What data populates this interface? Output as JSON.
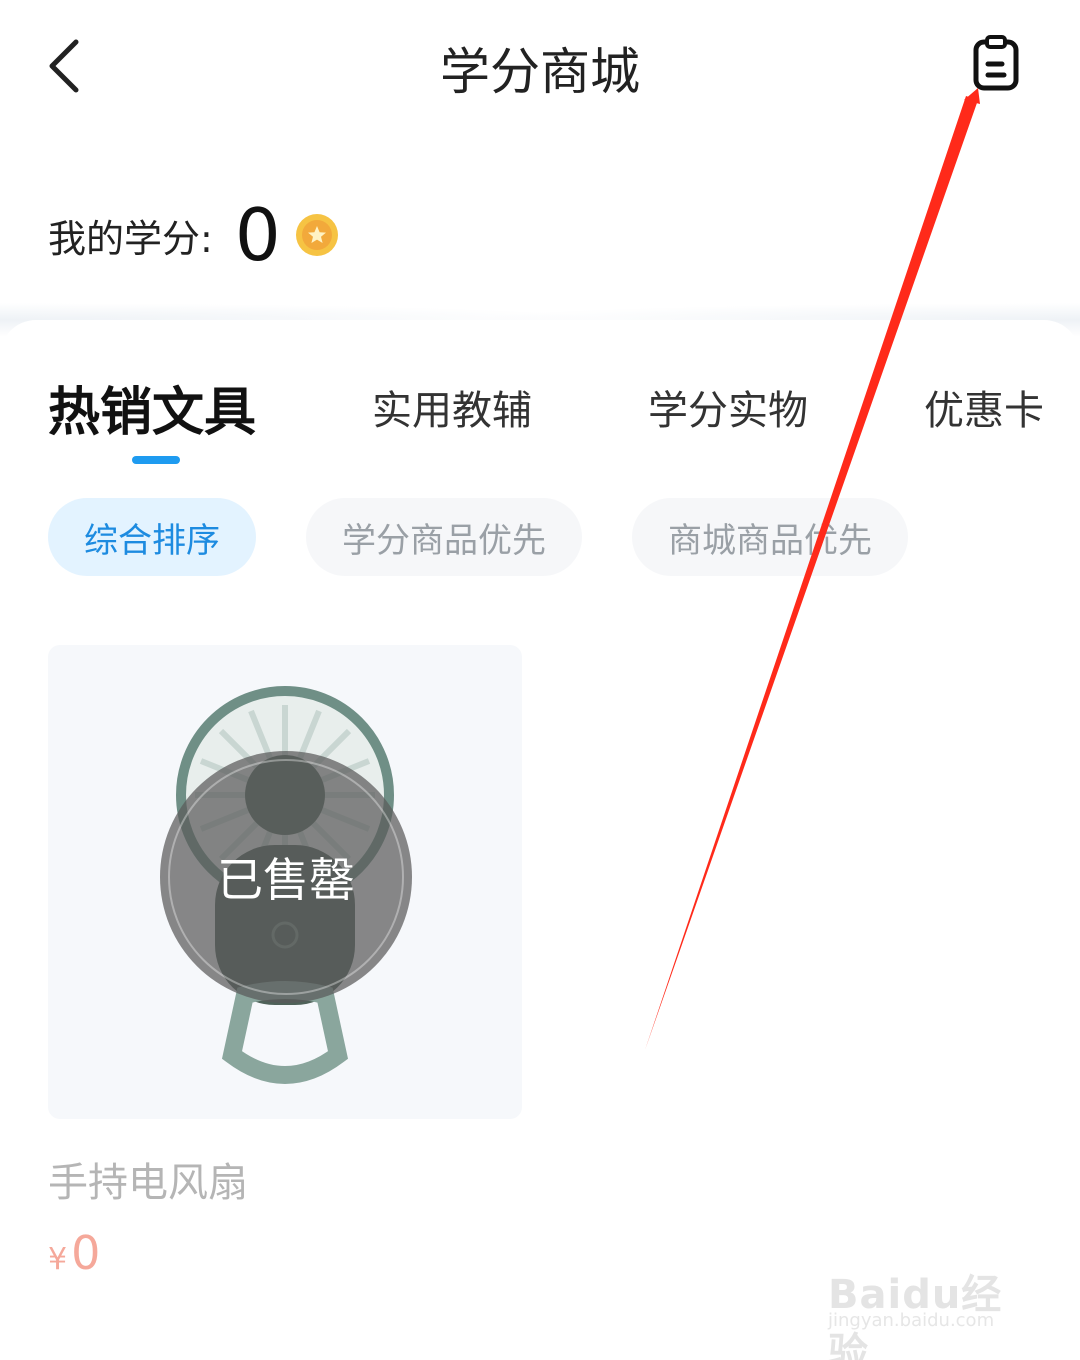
{
  "header": {
    "title": "学分商城",
    "back_icon": "chevron-left-icon",
    "orders_icon": "clipboard-icon"
  },
  "credits": {
    "label": "我的学分:",
    "value": "0",
    "coin_icon": "gold-coin-icon"
  },
  "tabs": [
    {
      "label": "热销文具",
      "active": true
    },
    {
      "label": "实用教辅",
      "active": false
    },
    {
      "label": "学分实物",
      "active": false
    },
    {
      "label": "优惠卡",
      "active": false
    }
  ],
  "sort_chips": [
    {
      "label": "综合排序",
      "active": true
    },
    {
      "label": "学分商品优先",
      "active": false
    },
    {
      "label": "商城商品优先",
      "active": false
    }
  ],
  "products": [
    {
      "name": "手持电风扇",
      "currency": "¥",
      "price": "0",
      "status": "已售罄"
    }
  ],
  "watermark": {
    "brand": "Baidu经验",
    "url": "jingyan.baidu.com"
  },
  "colors": {
    "accent": "#1e9bf0",
    "chip_active_bg": "#e3f3ff",
    "price": "#f5a89a",
    "annotation_arrow": "#ff2a1a"
  }
}
